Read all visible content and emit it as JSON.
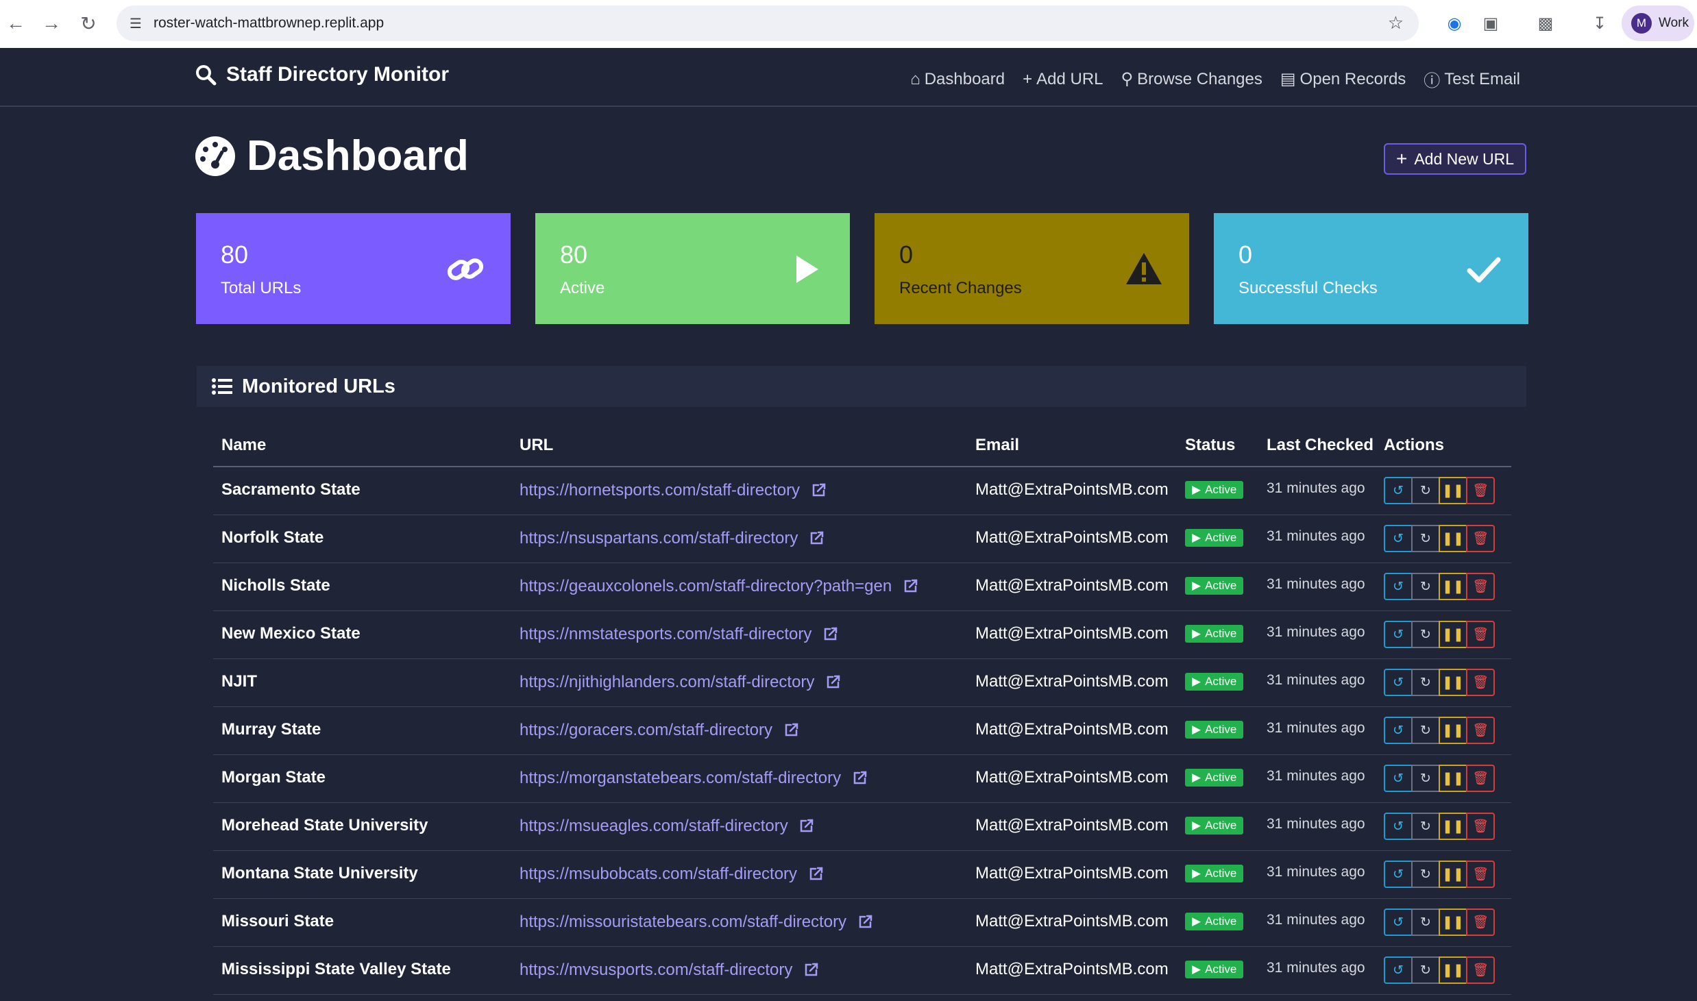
{
  "browser": {
    "url": "roster-watch-mattbrownep.replit.app",
    "profile_initial": "M",
    "profile_name": "Work"
  },
  "app": {
    "brand": "Staff Directory Monitor",
    "nav": [
      {
        "label": "Dashboard",
        "icon": "home-icon"
      },
      {
        "label": "Add URL",
        "icon": "plus-icon"
      },
      {
        "label": "Browse Changes",
        "icon": "search-icon"
      },
      {
        "label": "Open Records",
        "icon": "document-icon"
      },
      {
        "label": "Test Email",
        "icon": "info-icon"
      }
    ]
  },
  "page": {
    "title": "Dashboard",
    "add_button": "Add New URL"
  },
  "stats": [
    {
      "value": "80",
      "label": "Total URLs",
      "color": "#7a5cff",
      "icon": "link-icon"
    },
    {
      "value": "80",
      "label": "Active",
      "color": "#78d87a",
      "icon": "play-icon"
    },
    {
      "value": "0",
      "label": "Recent Changes",
      "color": "#937d00",
      "icon": "warning-icon"
    },
    {
      "value": "0",
      "label": "Successful Checks",
      "color": "#45b7d6",
      "icon": "check-icon"
    }
  ],
  "section": {
    "title": "Monitored URLs"
  },
  "table": {
    "headers": [
      "Name",
      "URL",
      "Email",
      "Status",
      "Last Checked",
      "Actions"
    ],
    "rows": [
      {
        "name": "Sacramento State",
        "url": "https://hornetsports.com/staff-directory",
        "email": "Matt@ExtraPointsMB.com",
        "status": "Active",
        "last": "31 minutes ago"
      },
      {
        "name": "Norfolk State",
        "url": "https://nsuspartans.com/staff-directory",
        "email": "Matt@ExtraPointsMB.com",
        "status": "Active",
        "last": "31 minutes ago"
      },
      {
        "name": "Nicholls State",
        "url": "https://geauxcolonels.com/staff-directory?path=gen",
        "email": "Matt@ExtraPointsMB.com",
        "status": "Active",
        "last": "31 minutes ago"
      },
      {
        "name": "New Mexico State",
        "url": "https://nmstatesports.com/staff-directory",
        "email": "Matt@ExtraPointsMB.com",
        "status": "Active",
        "last": "31 minutes ago"
      },
      {
        "name": "NJIT",
        "url": "https://njithighlanders.com/staff-directory",
        "email": "Matt@ExtraPointsMB.com",
        "status": "Active",
        "last": "31 minutes ago"
      },
      {
        "name": "Murray State",
        "url": "https://goracers.com/staff-directory",
        "email": "Matt@ExtraPointsMB.com",
        "status": "Active",
        "last": "31 minutes ago"
      },
      {
        "name": "Morgan State",
        "url": "https://morganstatebears.com/staff-directory",
        "email": "Matt@ExtraPointsMB.com",
        "status": "Active",
        "last": "31 minutes ago"
      },
      {
        "name": "Morehead State University",
        "url": "https://msueagles.com/staff-directory",
        "email": "Matt@ExtraPointsMB.com",
        "status": "Active",
        "last": "31 minutes ago"
      },
      {
        "name": "Montana State University",
        "url": "https://msubobcats.com/staff-directory",
        "email": "Matt@ExtraPointsMB.com",
        "status": "Active",
        "last": "31 minutes ago"
      },
      {
        "name": "Missouri State",
        "url": "https://missouristatebears.com/staff-directory",
        "email": "Matt@ExtraPointsMB.com",
        "status": "Active",
        "last": "31 minutes ago"
      },
      {
        "name": "Mississippi State Valley State",
        "url": "https://mvsusports.com/staff-directory",
        "email": "Matt@ExtraPointsMB.com",
        "status": "Active",
        "last": "31 minutes ago"
      }
    ]
  }
}
